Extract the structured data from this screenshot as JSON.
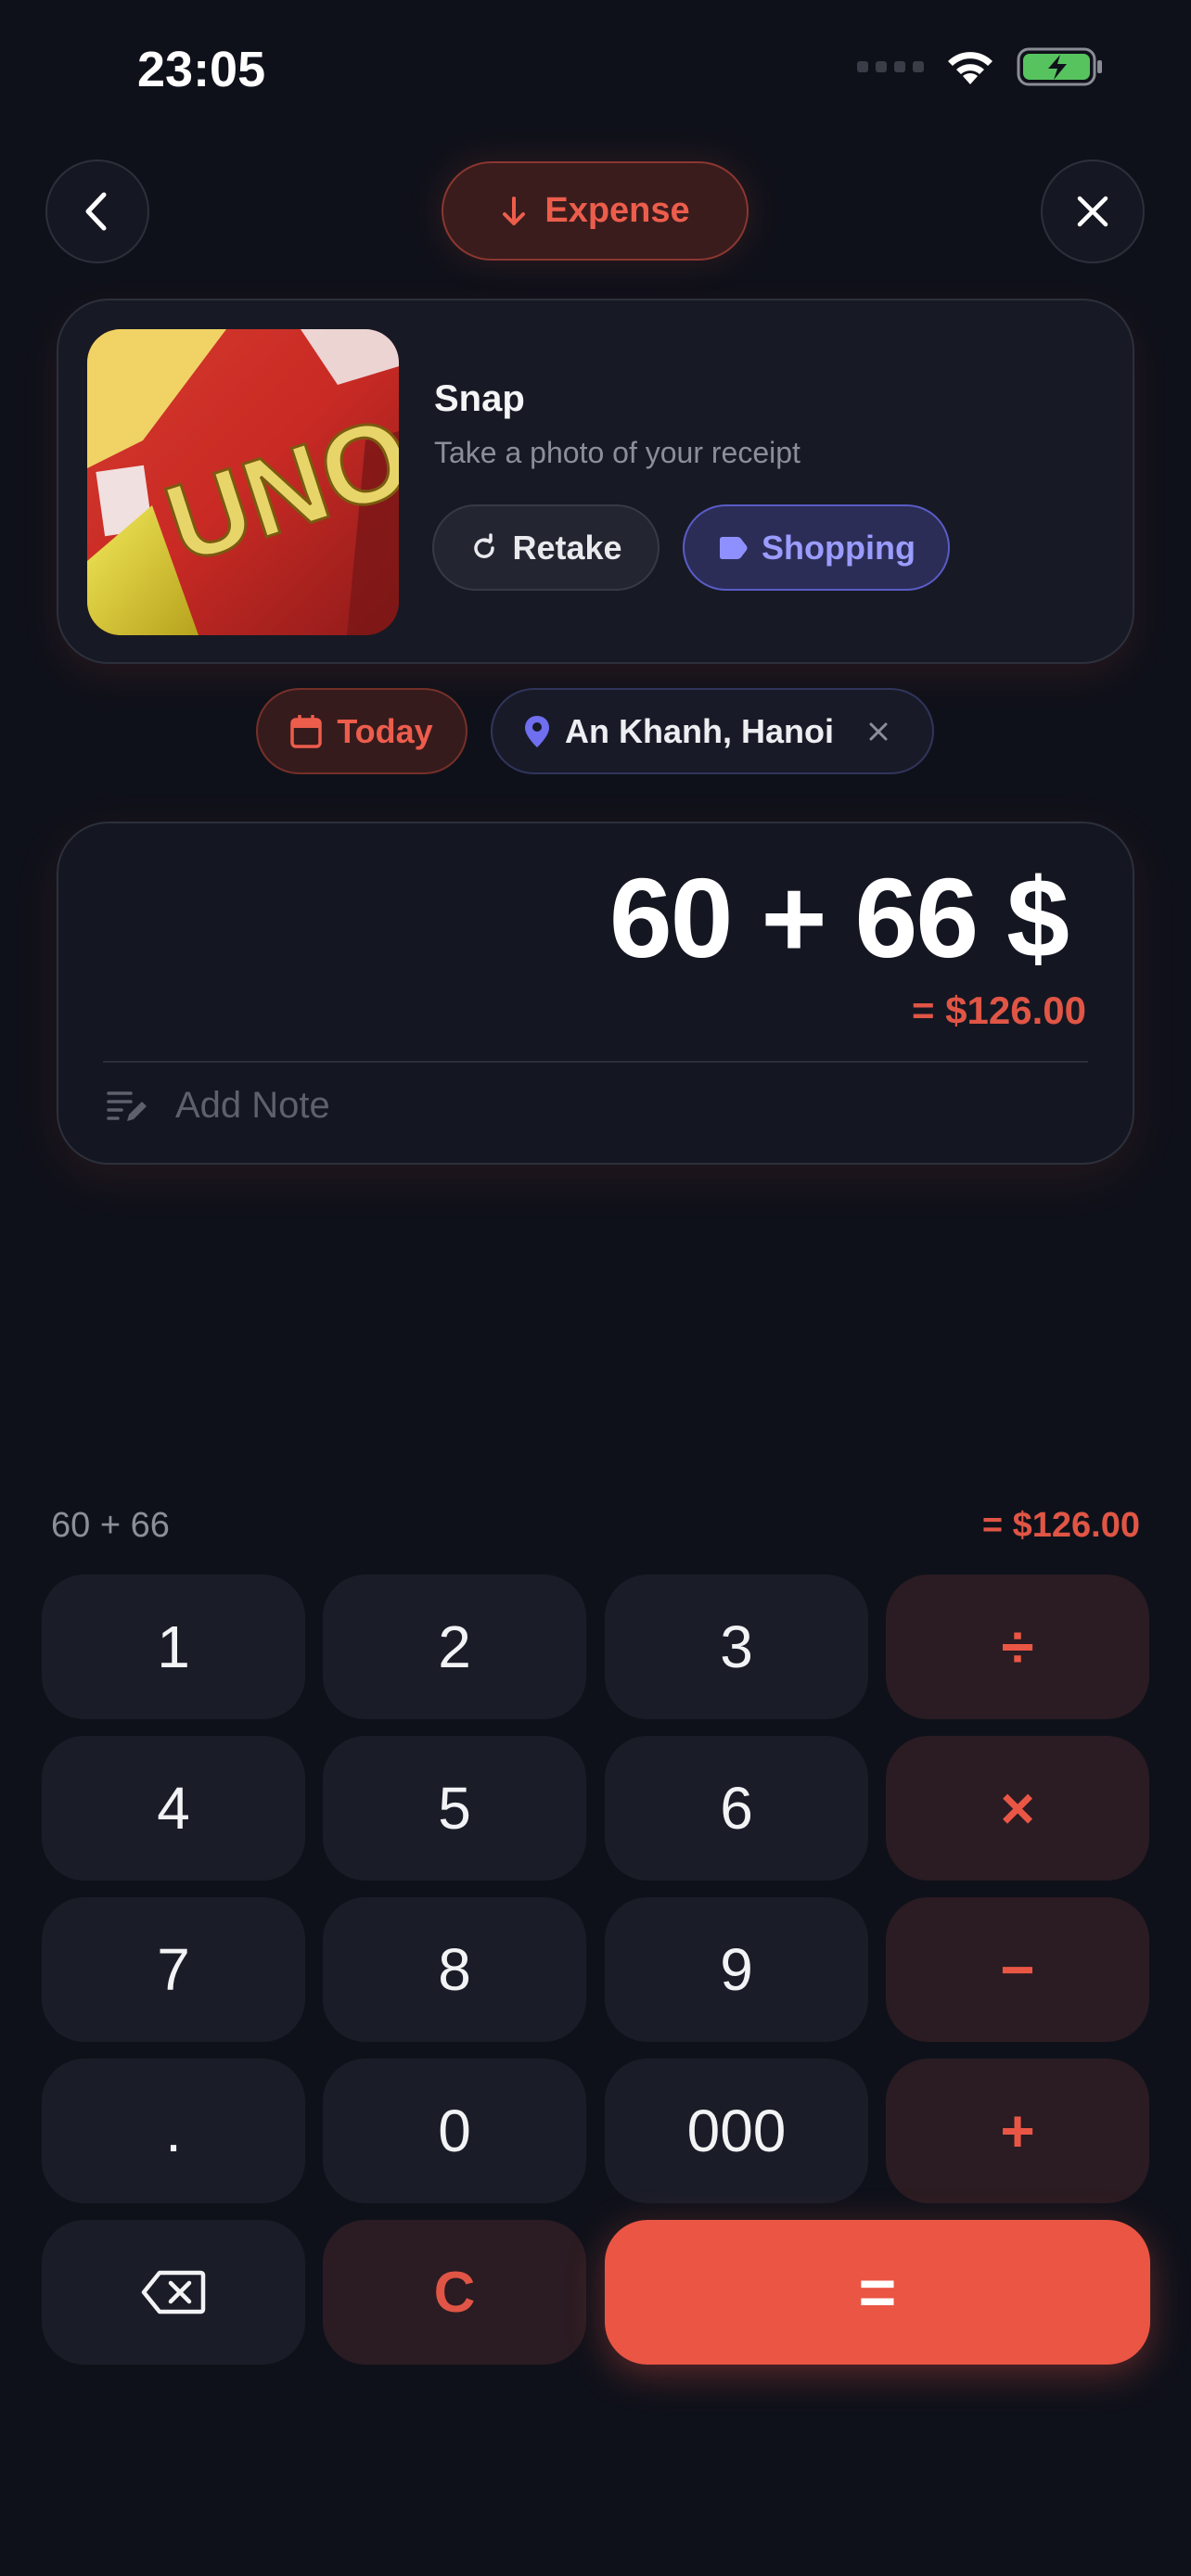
{
  "status_bar": {
    "time": "23:05"
  },
  "header": {
    "type_label": "Expense",
    "accent_color": "#ea5544"
  },
  "receipt": {
    "title": "Snap",
    "subtitle": "Take a photo of your receipt",
    "retake_label": "Retake",
    "category_label": "Shopping",
    "photo_text": "UNO"
  },
  "chips": {
    "date_label": "Today",
    "location_label": "An Khanh, Hanoi"
  },
  "amount": {
    "expression": "60 + 66 $",
    "result": "= $126.00",
    "note_placeholder": "Add Note"
  },
  "keypad": {
    "expression": "60 + 66",
    "result": "= $126.00",
    "keys": {
      "k1": "1",
      "k2": "2",
      "k3": "3",
      "div": "÷",
      "k4": "4",
      "k5": "5",
      "k6": "6",
      "mul": "×",
      "k7": "7",
      "k8": "8",
      "k9": "9",
      "sub": "−",
      "dot": ".",
      "k0": "0",
      "k000": "000",
      "add": "+",
      "clear": "C",
      "equals": "="
    }
  }
}
